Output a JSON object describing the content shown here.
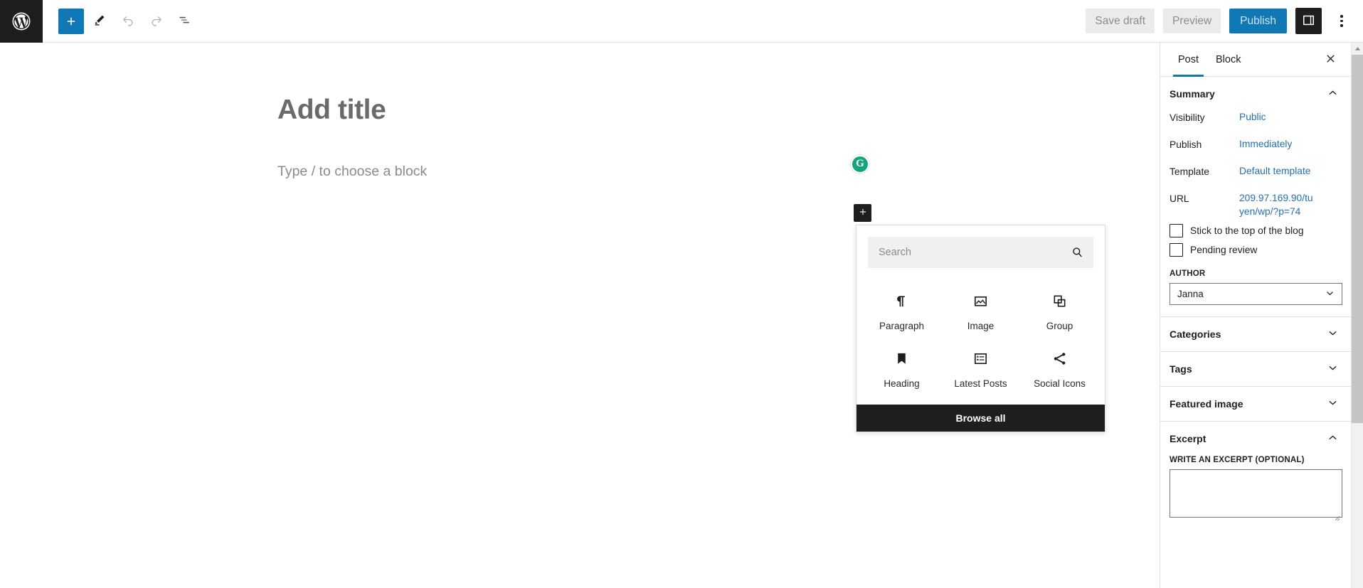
{
  "toolbar": {
    "logo_title": "WordPress",
    "add_block_label": "Toggle block inserter",
    "tools_label": "Tools",
    "undo_label": "Undo",
    "redo_label": "Redo",
    "document_overview_label": "Document Overview",
    "save_draft_label": "Save draft",
    "preview_label": "Preview",
    "publish_label": "Publish",
    "sidebar_toggle_label": "Settings",
    "options_label": "Options",
    "accent_blue": "#1078b4",
    "dark": "#1e1e1e"
  },
  "editor": {
    "title_placeholder": "Add title",
    "paragraph_placeholder": "Type / to choose a block",
    "grammarly_badge": "G",
    "grammarly_color": "#15a47e",
    "appender_label": "Add block"
  },
  "inserter": {
    "search_placeholder": "Search",
    "search_value": "",
    "blocks": [
      {
        "label": "Paragraph",
        "icon": "paragraph-icon"
      },
      {
        "label": "Image",
        "icon": "image-icon"
      },
      {
        "label": "Group",
        "icon": "group-icon"
      },
      {
        "label": "Heading",
        "icon": "heading-icon"
      },
      {
        "label": "Latest Posts",
        "icon": "latest-posts-icon"
      },
      {
        "label": "Social Icons",
        "icon": "social-icons-icon"
      }
    ],
    "browse_all_label": "Browse all"
  },
  "sidebar": {
    "tabs": [
      {
        "label": "Post",
        "active": true
      },
      {
        "label": "Block",
        "active": false
      }
    ],
    "close_label": "Close settings",
    "summary": {
      "title": "Summary",
      "expanded": true,
      "rows": [
        {
          "key": "Visibility",
          "value": "Public"
        },
        {
          "key": "Publish",
          "value": "Immediately"
        },
        {
          "key": "Template",
          "value": "Default template"
        },
        {
          "key": "URL",
          "value": "209.97.169.90/tuyen/wp/?p=74"
        }
      ],
      "checkboxes": [
        {
          "label": "Stick to the top of the blog",
          "checked": false
        },
        {
          "label": "Pending review",
          "checked": false
        }
      ],
      "author_label": "AUTHOR",
      "author_value": "Janna"
    },
    "sections": [
      {
        "title": "Categories",
        "expanded": false
      },
      {
        "title": "Tags",
        "expanded": false
      },
      {
        "title": "Featured image",
        "expanded": false
      }
    ],
    "excerpt": {
      "title": "Excerpt",
      "expanded": true,
      "field_label": "WRITE AN EXCERPT (OPTIONAL)",
      "value": ""
    },
    "link_color": "#2271b1"
  }
}
